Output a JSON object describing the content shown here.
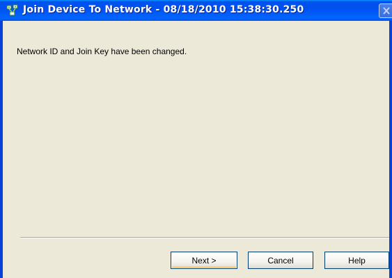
{
  "window": {
    "title": "Join Device To Network - 08/18/2010 15:38:30.250",
    "icon": "network-devices-icon",
    "close_icon": "close-icon"
  },
  "content": {
    "message": "Network ID and Join Key have been changed."
  },
  "buttons": {
    "next_label": "Next >",
    "cancel_label": "Cancel",
    "help_label": "Help"
  },
  "colors": {
    "titlebar": "#0054e3",
    "window_background": "#ece9d8",
    "title_text": "#ffffff"
  }
}
